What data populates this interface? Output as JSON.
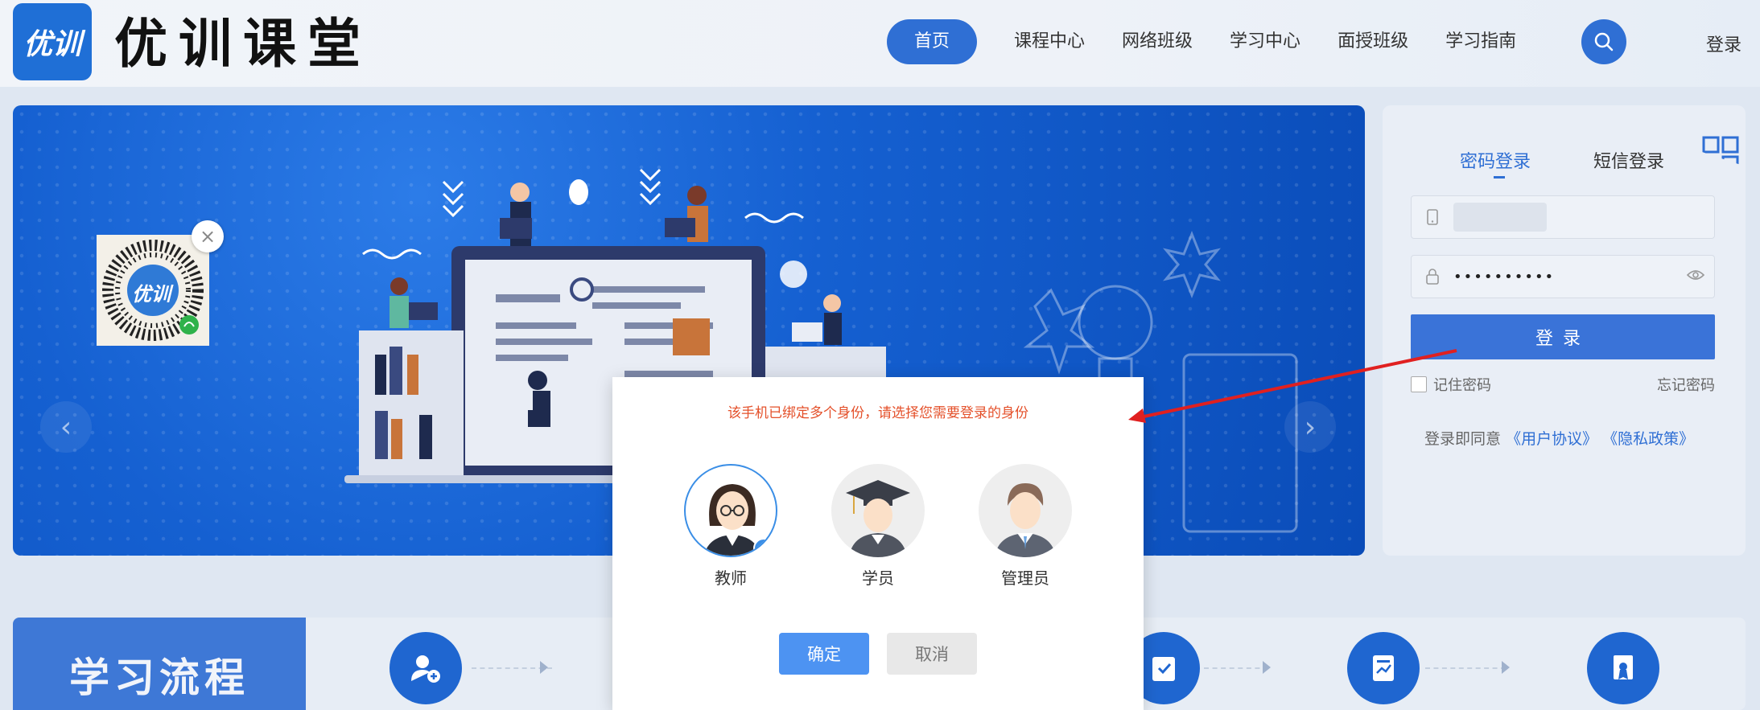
{
  "header": {
    "logo_mark": "优训",
    "logo_text": "优训课堂",
    "nav": [
      {
        "label": "首页",
        "active": true
      },
      {
        "label": "课程中心",
        "active": false
      },
      {
        "label": "网络班级",
        "active": false
      },
      {
        "label": "学习中心",
        "active": false
      },
      {
        "label": "面授班级",
        "active": false
      },
      {
        "label": "学习指南",
        "active": false
      }
    ],
    "search_icon": "search-icon",
    "login_label": "登录"
  },
  "banner": {
    "prev_icon": "chevron-left-icon",
    "next_icon": "chevron-right-icon",
    "qr_logo": "优训",
    "qr_close_icon": "close-icon"
  },
  "login_panel": {
    "tab_password": "密码登录",
    "tab_sms": "短信登录",
    "phone_icon": "phone-icon",
    "lock_icon": "lock-icon",
    "password_value": "••••••••••",
    "eye_icon": "eye-icon",
    "login_button": "登录",
    "remember_label": "记住密码",
    "forgot_label": "忘记密码",
    "agree_prefix": "登录即同意",
    "user_agreement": "《用户协议》",
    "privacy_policy": "《隐私政策》"
  },
  "process": {
    "title": "学习流程"
  },
  "dialog": {
    "message": "该手机已绑定多个身份，请选择您需要登录的身份",
    "roles": [
      {
        "label": "教师",
        "selected": true
      },
      {
        "label": "学员",
        "selected": false
      },
      {
        "label": "管理员",
        "selected": false
      }
    ],
    "confirm": "确定",
    "cancel": "取消"
  },
  "colors": {
    "primary": "#2f6fd4",
    "dialog_message": "#e4502a",
    "annotation_arrow": "#e02020"
  }
}
